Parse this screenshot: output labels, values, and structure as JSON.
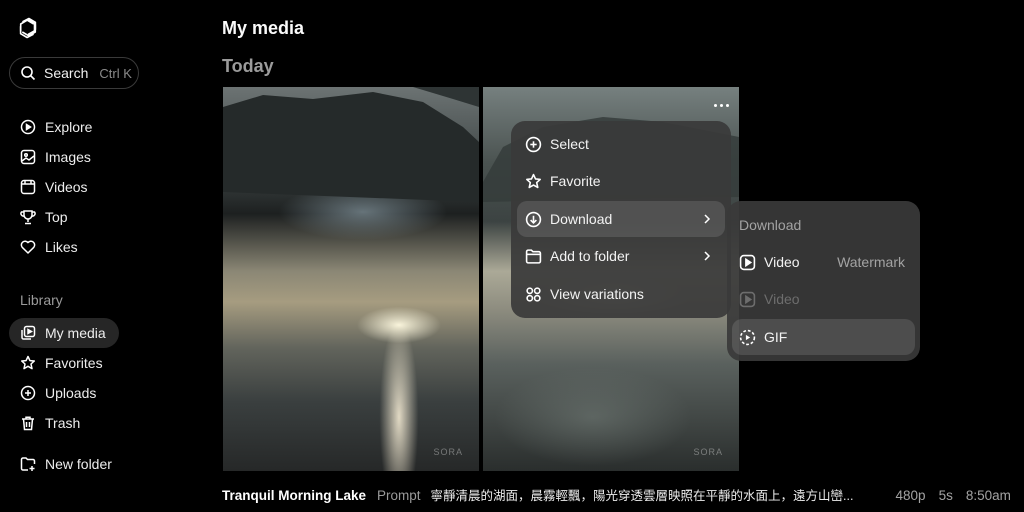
{
  "sidebar": {
    "search": {
      "label": "Search",
      "shortcut": "Ctrl K"
    },
    "nav": [
      {
        "label": "Explore",
        "icon": "explore-icon"
      },
      {
        "label": "Images",
        "icon": "image-icon"
      },
      {
        "label": "Videos",
        "icon": "video-icon"
      },
      {
        "label": "Top",
        "icon": "trophy-icon"
      },
      {
        "label": "Likes",
        "icon": "heart-icon"
      }
    ],
    "library_label": "Library",
    "library": [
      {
        "label": "My media",
        "icon": "media-icon",
        "active": true
      },
      {
        "label": "Favorites",
        "icon": "star-icon"
      },
      {
        "label": "Uploads",
        "icon": "upload-icon"
      },
      {
        "label": "Trash",
        "icon": "trash-icon"
      }
    ],
    "new_folder": "New folder"
  },
  "main": {
    "title": "My media",
    "date_heading": "Today",
    "watermark": "SORA"
  },
  "context_menu": {
    "items": [
      {
        "label": "Select",
        "icon": "plus-circle-icon"
      },
      {
        "label": "Favorite",
        "icon": "star-icon"
      },
      {
        "label": "Download",
        "icon": "download-icon",
        "has_submenu": true,
        "highlighted": true
      },
      {
        "label": "Add to folder",
        "icon": "folder-icon",
        "has_submenu": true
      },
      {
        "label": "View variations",
        "icon": "grid-icon"
      }
    ]
  },
  "download_submenu": {
    "title": "Download",
    "items": [
      {
        "label": "Video",
        "note": "Watermark",
        "icon": "video-play-icon",
        "disabled": false
      },
      {
        "label": "Video",
        "icon": "video-play-icon",
        "disabled": true
      },
      {
        "label": "GIF",
        "icon": "gif-icon",
        "highlighted": true
      }
    ]
  },
  "caption": {
    "title": "Tranquil Morning Lake",
    "prompt_label": "Prompt",
    "prompt": "寧靜清晨的湖面，晨霧輕飄，陽光穿透雲層映照在平靜的水面上，遠方山巒...",
    "resolution": "480p",
    "duration": "5s",
    "time": "8:50am"
  },
  "colors": {
    "background": "#000000",
    "menu": "#3a3a3a",
    "active_nav": "#262626"
  }
}
